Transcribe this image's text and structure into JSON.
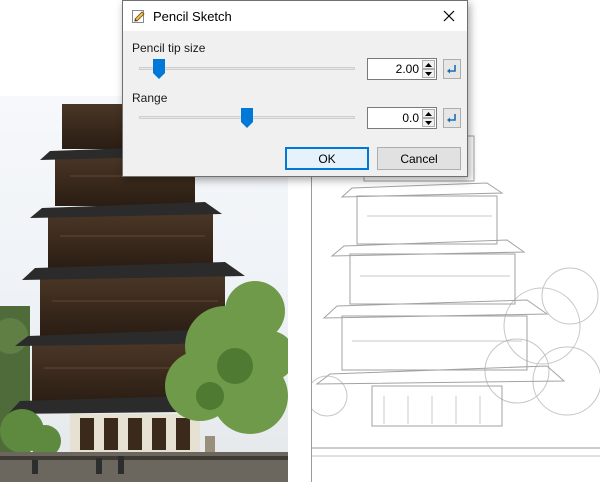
{
  "dialog": {
    "title": "Pencil Sketch",
    "pencil_tip": {
      "label": "Pencil tip size",
      "value": "2.00",
      "slider_level": 0.07
    },
    "range": {
      "label": "Range",
      "value": "0.0",
      "slider_level": 0.5
    },
    "ok_label": "OK",
    "cancel_label": "Cancel"
  },
  "colors": {
    "accent": "#0078d7",
    "dialog_bg": "#f0f0f0",
    "pagoda_wood": "#3b2a1c",
    "foliage": "#6f9a4a"
  },
  "icons": {
    "title": "pencil-sketch-icon",
    "close": "close-icon",
    "reset": "reset-arrow-icon"
  }
}
